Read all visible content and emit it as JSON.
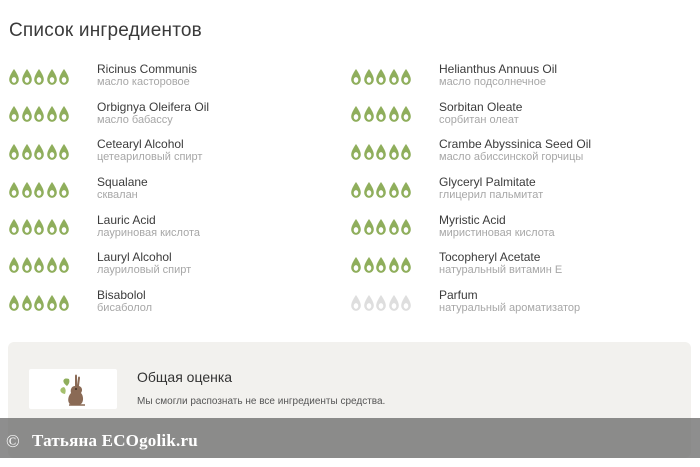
{
  "title": "Список ингредиентов",
  "colors": {
    "rated": "#8fae5c",
    "unrated": "#dedede"
  },
  "ingredients": [
    {
      "name": "Ricinus Communis",
      "sub": "масло касторовое",
      "rating": 5
    },
    {
      "name": "Helianthus Annuus Oil",
      "sub": "масло подсолнечное",
      "rating": 5
    },
    {
      "name": "Orbignya Oleifera Oil",
      "sub": "масло бабассу",
      "rating": 5
    },
    {
      "name": "Sorbitan Oleate",
      "sub": "сорбитан олеат",
      "rating": 5
    },
    {
      "name": "Cetearyl Alcohol",
      "sub": "цетеариловый спирт",
      "rating": 5
    },
    {
      "name": "Crambe Abyssinica Seed Oil",
      "sub": "масло абиссинской горчицы",
      "rating": 5
    },
    {
      "name": "Squalane",
      "sub": "сквалан",
      "rating": 5
    },
    {
      "name": "Glyceryl Palmitate",
      "sub": "глицерил пальмитат",
      "rating": 5
    },
    {
      "name": "Lauric Acid",
      "sub": "лауриновая кислота",
      "rating": 5
    },
    {
      "name": "Myristic Acid",
      "sub": "миристиновая кислота",
      "rating": 5
    },
    {
      "name": "Lauryl Alcohol",
      "sub": "лауриловый спирт",
      "rating": 5
    },
    {
      "name": "Tocopheryl Acetate",
      "sub": "натуральный витамин Е",
      "rating": 5
    },
    {
      "name": "Bisabolol",
      "sub": "бисаболол",
      "rating": 5
    },
    {
      "name": "Parfum",
      "sub": "натуральный ароматизатор",
      "rating": 0
    }
  ],
  "summary": {
    "title": "Общая оценка",
    "text": "Мы смогли распознать не все ингредиенты средства."
  },
  "watermark": {
    "copyright": "©",
    "text": "Татьяна  ECOgolik.ru"
  }
}
